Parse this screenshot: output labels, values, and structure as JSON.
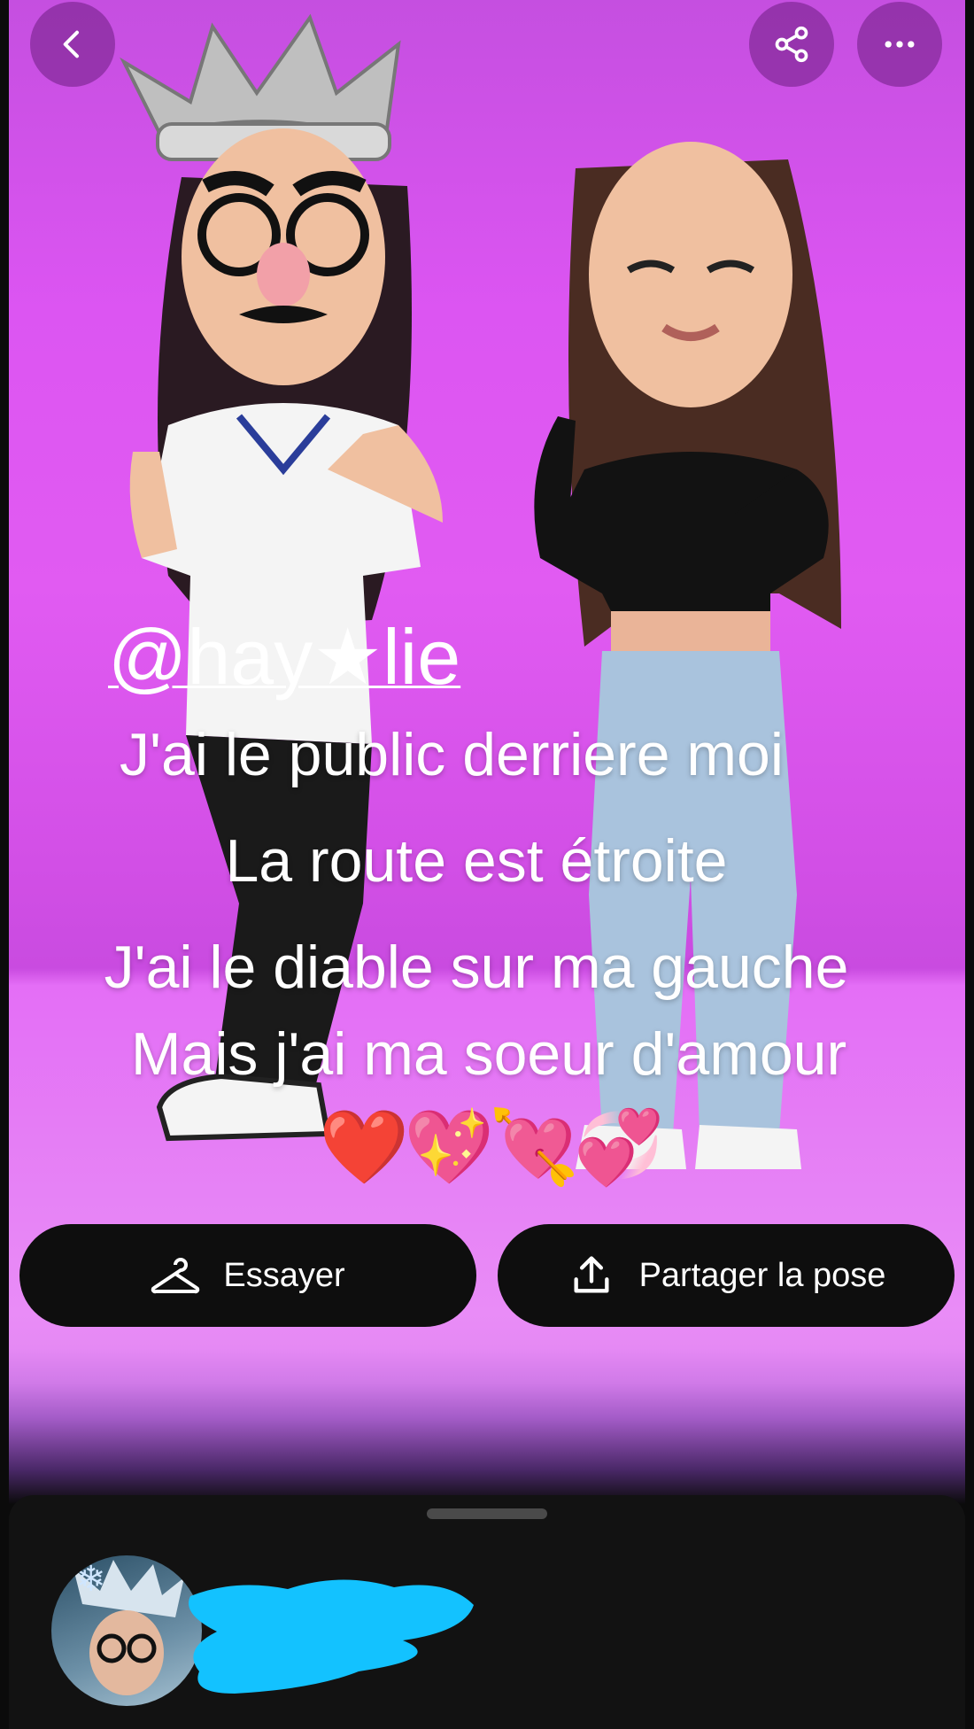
{
  "header": {
    "back_icon": "chevron-left-icon",
    "share_icon": "share-nodes-icon",
    "more_icon": "more-dots-icon"
  },
  "overlay": {
    "handle": "@hay★lie",
    "lines": [
      "J'ai le public derriere moi",
      "La route est étroite",
      "J'ai le diable sur ma gauche",
      "Mais j'ai ma soeur d'amour"
    ],
    "emojis": "❤️💖💘💞"
  },
  "actions": {
    "try_label": "Essayer",
    "try_icon": "hanger-icon",
    "share_pose_label": "Partager la pose",
    "share_pose_icon": "upload-icon"
  },
  "colors": {
    "background_top": "#dc55f2",
    "floor": "#e98cf7",
    "button_bg": "#0e0e0e",
    "redaction": "#13c2ff"
  }
}
